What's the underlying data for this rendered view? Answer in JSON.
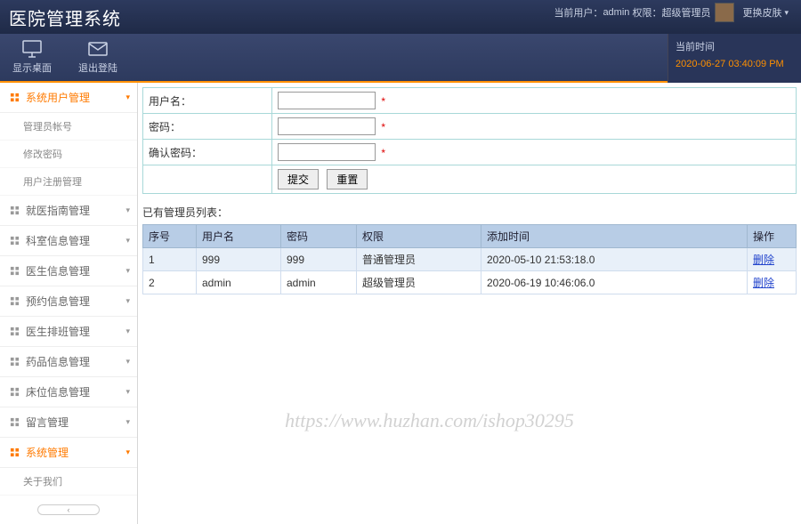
{
  "header": {
    "title": "医院管理系统",
    "current_user_label": "当前用户：",
    "current_user": "admin",
    "role_label": "权限：",
    "role": "超级管理员",
    "skin_btn": "更换皮肤"
  },
  "toolbar": {
    "desktop": "显示桌面",
    "logout": "退出登陆"
  },
  "time_panel": {
    "label": "当前时间",
    "value": "2020-06-27 03:40:09 PM"
  },
  "sidebar": {
    "items": [
      {
        "label": "系统用户管理",
        "active": true,
        "expanded": true,
        "children": [
          "管理员帐号",
          "修改密码",
          "用户注册管理"
        ]
      },
      {
        "label": "就医指南管理"
      },
      {
        "label": "科室信息管理"
      },
      {
        "label": "医生信息管理"
      },
      {
        "label": "预约信息管理"
      },
      {
        "label": "医生排班管理"
      },
      {
        "label": "药品信息管理"
      },
      {
        "label": "床位信息管理"
      },
      {
        "label": "留言管理"
      },
      {
        "label": "系统管理",
        "active": true,
        "children_collapsed": [
          "关于我们"
        ]
      },
      {
        "label": "关于我们",
        "plain": true
      }
    ]
  },
  "form": {
    "username_label": "用户名：",
    "password_label": "密码：",
    "confirm_label": "确认密码：",
    "star": "*",
    "submit": "提交",
    "reset": "重置"
  },
  "list_title": "已有管理员列表：",
  "table": {
    "headers": [
      "序号",
      "用户名",
      "密码",
      "权限",
      "添加时间",
      "操作"
    ],
    "rows": [
      {
        "seq": "1",
        "user": "999",
        "pwd": "999",
        "role": "普通管理员",
        "time": "2020-05-10 21:53:18.0",
        "op": "删除"
      },
      {
        "seq": "2",
        "user": "admin",
        "pwd": "admin",
        "role": "超级管理员",
        "time": "2020-06-19 10:46:06.0",
        "op": "删除"
      }
    ]
  },
  "watermark": "https://www.huzhan.com/ishop30295"
}
